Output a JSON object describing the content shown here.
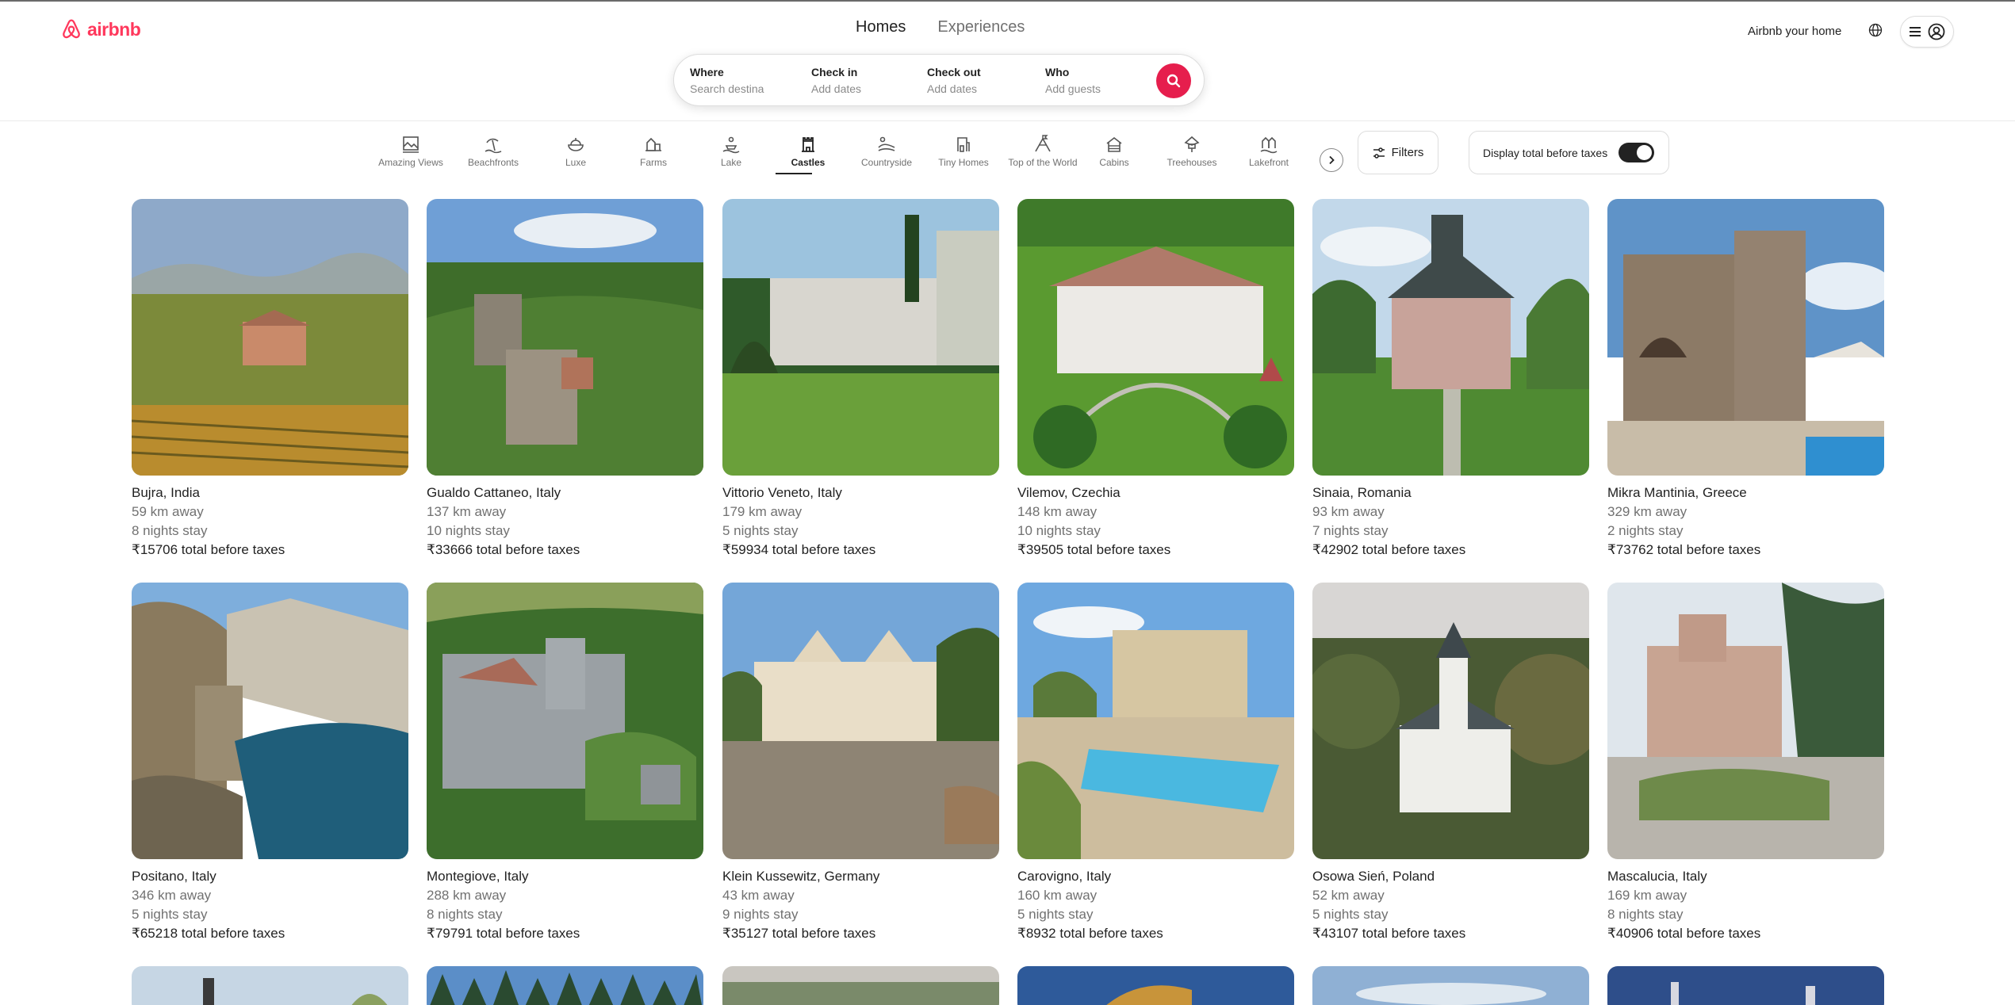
{
  "brand": {
    "name": "airbnb",
    "color": "#FF385C",
    "icon": "airbnb-logo-icon"
  },
  "header": {
    "tabs": [
      {
        "label": "Homes",
        "active": true
      },
      {
        "label": "Experiences",
        "active": false
      }
    ],
    "host_link": "Airbnb your home",
    "globe_icon": "globe-icon",
    "menu_icons": [
      "hamburger-icon",
      "user-icon"
    ]
  },
  "search": {
    "where": {
      "label": "Where",
      "placeholder": "Search destina"
    },
    "check_in": {
      "label": "Check in",
      "value": "Add dates"
    },
    "check_out": {
      "label": "Check out",
      "value": "Add dates"
    },
    "who": {
      "label": "Who",
      "value": "Add guests"
    },
    "button_icon": "search-icon",
    "button_color": "#E61E4D"
  },
  "categories": {
    "items": [
      {
        "label": "Amazing Views",
        "icon": "amazing-views-icon",
        "active": false
      },
      {
        "label": "Beachfronts",
        "icon": "beachfront-icon",
        "active": false
      },
      {
        "label": "Luxe",
        "icon": "luxe-icon",
        "active": false
      },
      {
        "label": "Farms",
        "icon": "farm-icon",
        "active": false
      },
      {
        "label": "Lake",
        "icon": "lake-icon",
        "active": false
      },
      {
        "label": "Castles",
        "icon": "castle-icon",
        "active": true
      },
      {
        "label": "Countryside",
        "icon": "countryside-icon",
        "active": false
      },
      {
        "label": "Tiny Homes",
        "icon": "tiny-home-icon",
        "active": false
      },
      {
        "label": "Top of the World",
        "icon": "top-of-world-icon",
        "active": false
      },
      {
        "label": "Cabins",
        "icon": "cabin-icon",
        "active": false
      },
      {
        "label": "Treehouses",
        "icon": "treehouse-icon",
        "active": false
      },
      {
        "label": "Lakefront",
        "icon": "lakefront-icon",
        "active": false
      }
    ],
    "next_icon": "chevron-right-icon",
    "filters_label": "Filters",
    "filters_icon": "sliders-icon",
    "taxes_toggle_label": "Display total before taxes",
    "taxes_toggle_on": true
  },
  "listings": [
    {
      "location": "Bujra, India",
      "distance": "59 km away",
      "stay": "8 nights stay",
      "price": "₹15706 total before taxes"
    },
    {
      "location": "Gualdo Cattaneo, Italy",
      "distance": "137 km away",
      "stay": "10 nights stay",
      "price": "₹33666 total before taxes"
    },
    {
      "location": "Vittorio Veneto, Italy",
      "distance": "179 km away",
      "stay": "5 nights stay",
      "price": "₹59934 total before taxes"
    },
    {
      "location": "Vilemov, Czechia",
      "distance": "148 km away",
      "stay": "10 nights stay",
      "price": "₹39505 total before taxes"
    },
    {
      "location": "Sinaia, Romania",
      "distance": "93 km away",
      "stay": "7 nights stay",
      "price": "₹42902 total before taxes"
    },
    {
      "location": "Mikra Mantinia, Greece",
      "distance": "329 km away",
      "stay": "2 nights stay",
      "price": "₹73762 total before taxes"
    },
    {
      "location": "Positano, Italy",
      "distance": "346 km away",
      "stay": "5 nights stay",
      "price": "₹65218 total before taxes"
    },
    {
      "location": "Montegiove, Italy",
      "distance": "288 km away",
      "stay": "8 nights stay",
      "price": "₹79791 total before taxes"
    },
    {
      "location": "Klein Kussewitz, Germany",
      "distance": "43 km away",
      "stay": "9 nights stay",
      "price": "₹35127 total before taxes"
    },
    {
      "location": "Carovigno, Italy",
      "distance": "160 km away",
      "stay": "5 nights stay",
      "price": "₹8932 total before taxes"
    },
    {
      "location": "Osowa Sień, Poland",
      "distance": "52 km away",
      "stay": "5 nights stay",
      "price": "₹43107 total before taxes"
    },
    {
      "location": "Mascalucia, Italy",
      "distance": "169 km away",
      "stay": "8 nights stay",
      "price": "₹40906 total before taxes"
    }
  ]
}
